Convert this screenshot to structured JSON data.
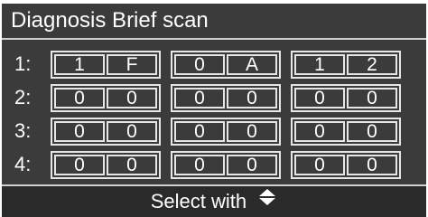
{
  "header": {
    "title": "Diagnosis Brief scan"
  },
  "rows": [
    {
      "label": "1:",
      "groups": [
        [
          "1",
          "F"
        ],
        [
          "0",
          "A"
        ],
        [
          "1",
          "2"
        ]
      ]
    },
    {
      "label": "2:",
      "groups": [
        [
          "0",
          "0"
        ],
        [
          "0",
          "0"
        ],
        [
          "0",
          "0"
        ]
      ]
    },
    {
      "label": "3:",
      "groups": [
        [
          "0",
          "0"
        ],
        [
          "0",
          "0"
        ],
        [
          "0",
          "0"
        ]
      ]
    },
    {
      "label": "4:",
      "groups": [
        [
          "0",
          "0"
        ],
        [
          "0",
          "0"
        ],
        [
          "0",
          "0"
        ]
      ]
    }
  ],
  "footer": {
    "hint": "Select with",
    "icon": "up-down-arrows-icon"
  },
  "colors": {
    "background": "#3b3b3b",
    "footer_background": "#2a2a2a",
    "text": "#ffffff",
    "border": "#e6e6e6"
  }
}
